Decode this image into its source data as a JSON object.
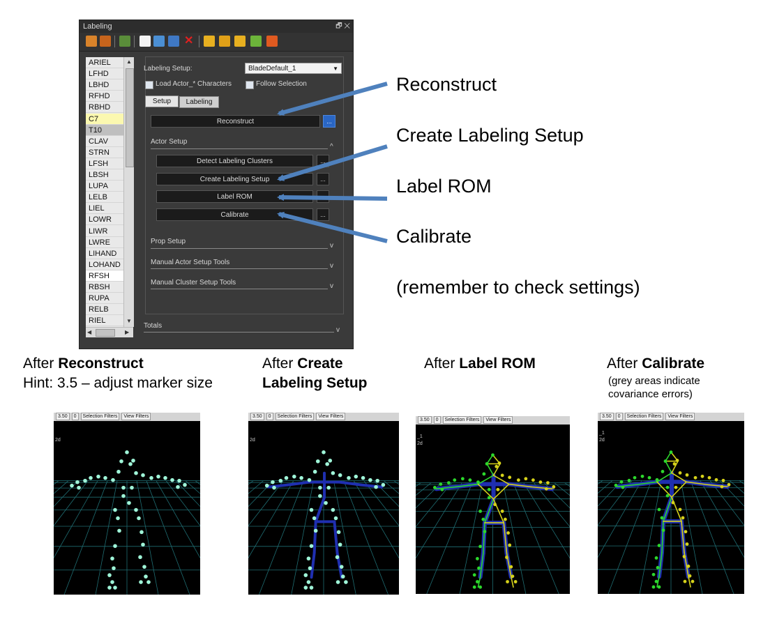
{
  "panel": {
    "title": "Labeling",
    "title_controls": "🗗 ✕",
    "markers": [
      "ARIEL",
      "LFHD",
      "LBHD",
      "RFHD",
      "RBHD",
      "C7",
      "T10",
      "CLAV",
      "STRN",
      "LFSH",
      "LBSH",
      "LUPA",
      "LELB",
      "LIEL",
      "LOWR",
      "LIWR",
      "LWRE",
      "LIHAND",
      "LOHAND",
      "RFSH",
      "RBSH",
      "RUPA",
      "RELB",
      "RIEL"
    ],
    "labeling_setup_label": "Labeling Setup:",
    "labeling_setup_value": "BladeDefault_1",
    "load_actor_label": "Load Actor_* Characters",
    "follow_selection_label": "Follow Selection",
    "tabs": [
      "Setup",
      "Labeling"
    ],
    "reconstruct_button": "Reconstruct",
    "dots": "...",
    "actor_setup_title": "Actor Setup",
    "actor_buttons": [
      "Detect Labeling Clusters",
      "Create Labeling Setup",
      "Label ROM",
      "Calibrate"
    ],
    "prop_setup": "Prop Setup",
    "manual_actor_tools": "Manual Actor Setup Tools",
    "manual_cluster_tools": "Manual Cluster Setup Tools",
    "totals": "Totals"
  },
  "callouts": {
    "reconstruct": "Reconstruct",
    "create_labeling_setup": "Create Labeling Setup",
    "label_rom": "Label ROM",
    "calibrate": "Calibrate",
    "remember": "(remember to check settings)"
  },
  "captions": {
    "after": "After",
    "reconstruct": "Reconstruct",
    "hint": "Hint: 3.5 – adjust marker size",
    "create": "Create",
    "labeling_setup": "Labeling Setup",
    "label_rom": "Label ROM",
    "calibrate": "Calibrate",
    "grey_note_1": "(grey areas indicate",
    "grey_note_2": "covariance errors)"
  },
  "viewport": {
    "size_value": "3.50",
    "count_value": "0",
    "selection_filters": "Selection Filters",
    "view_filters": "View Filters",
    "label_2d": "2d",
    "label_1": "_1"
  },
  "colors": {
    "marker": "#9ff5d8",
    "arrow": "#4f81bd",
    "bone_blue": "#1f2fb0",
    "bone_green": "#2cd82c",
    "bone_yellow": "#d6d21a",
    "highlight_row": "#fbf8b0",
    "grey_row": "#bfbfbf"
  }
}
